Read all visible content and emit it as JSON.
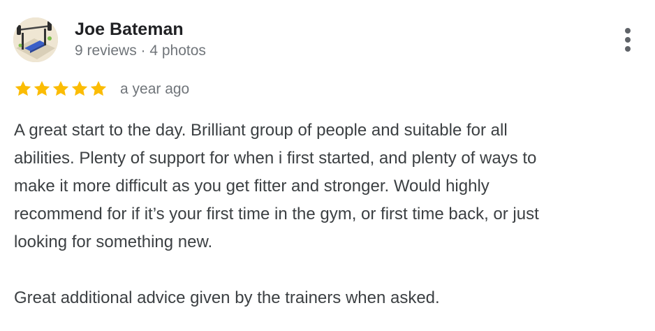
{
  "review": {
    "author": {
      "name": "Joe Bateman",
      "meta": "9 reviews · 4 photos",
      "avatar_icon": "gym-avatar-icon"
    },
    "rating": {
      "stars": 5,
      "max": 5,
      "star_color": "#fbbc04"
    },
    "time": "a year ago",
    "body_lines": [
      "A great start to the day. Brilliant group of people and suitable for all",
      "abilities. Plenty of support for when i first started, and plenty of ways to",
      "make it more difficult as you get fitter and stronger. Would highly",
      "recommend for if it’s your first time in the gym, or first time back, or just",
      "looking for something new.",
      "",
      "Great additional advice given by the trainers when asked."
    ],
    "more_icon": "more-vert-icon"
  }
}
